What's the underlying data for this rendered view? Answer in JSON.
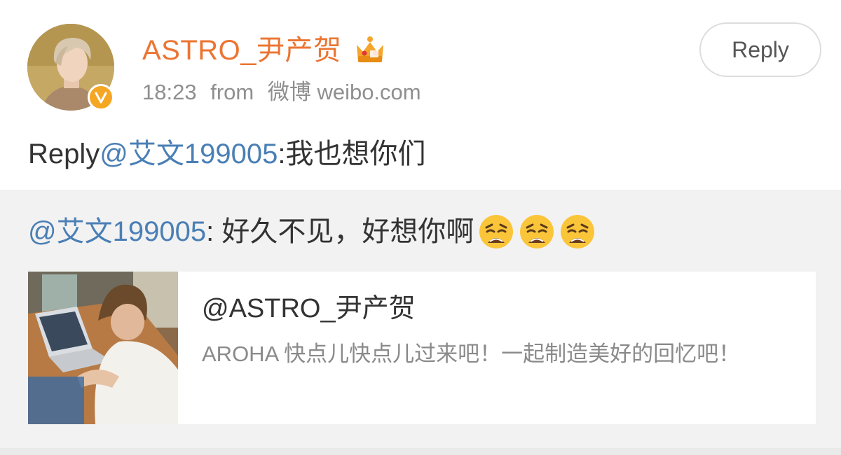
{
  "post": {
    "username": "ASTRO_尹产贺",
    "time": "18:23",
    "source_prefix": "from",
    "source": "微博 weibo.com",
    "reply_button": "Reply"
  },
  "comment": {
    "prefix": "Reply",
    "mention": "@艾文199005",
    "text": ":我也想你们"
  },
  "quoted": {
    "mention": "@艾文199005",
    "text": ": 好久不见，好想你啊",
    "emojis": [
      "weary-face",
      "weary-face",
      "weary-face"
    ]
  },
  "card": {
    "title": "@ASTRO_尹产贺",
    "description": "AROHA 快点儿快点儿过来吧！一起制造美好的回忆吧！"
  },
  "icons": {
    "verified": "verified-badge-icon",
    "crown": "crown-badge-icon"
  },
  "colors": {
    "username": "#eb7533",
    "mention": "#4a7fb5",
    "verified": "#f5a623",
    "quote_bg": "#f2f2f2"
  }
}
